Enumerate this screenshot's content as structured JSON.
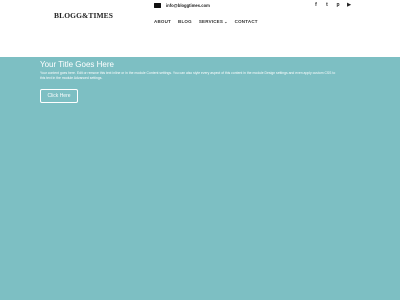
{
  "header": {
    "logo": "BLOGG&TIMES",
    "email": "info@bloggtimes.com",
    "socials": [
      {
        "icon": "facebook-icon",
        "glyph": "f"
      },
      {
        "icon": "twitter-icon",
        "glyph": "t"
      },
      {
        "icon": "pinterest-icon",
        "glyph": "p"
      },
      {
        "icon": "youtube-icon",
        "glyph": "▶"
      }
    ],
    "nav": {
      "about": "ABOUT",
      "blog": "BLOG",
      "services": "SERVICES",
      "contact": "CONTACT"
    }
  },
  "hero": {
    "title": "Your Title Goes Here",
    "body": "Your content goes here. Edit or remove this text inline or in the module Content settings. You can also style every aspect of this content in the module Design settings and even apply custom CSS to this text in the module Advanced settings.",
    "button": "Click Here",
    "background": "#7dbfc3"
  }
}
